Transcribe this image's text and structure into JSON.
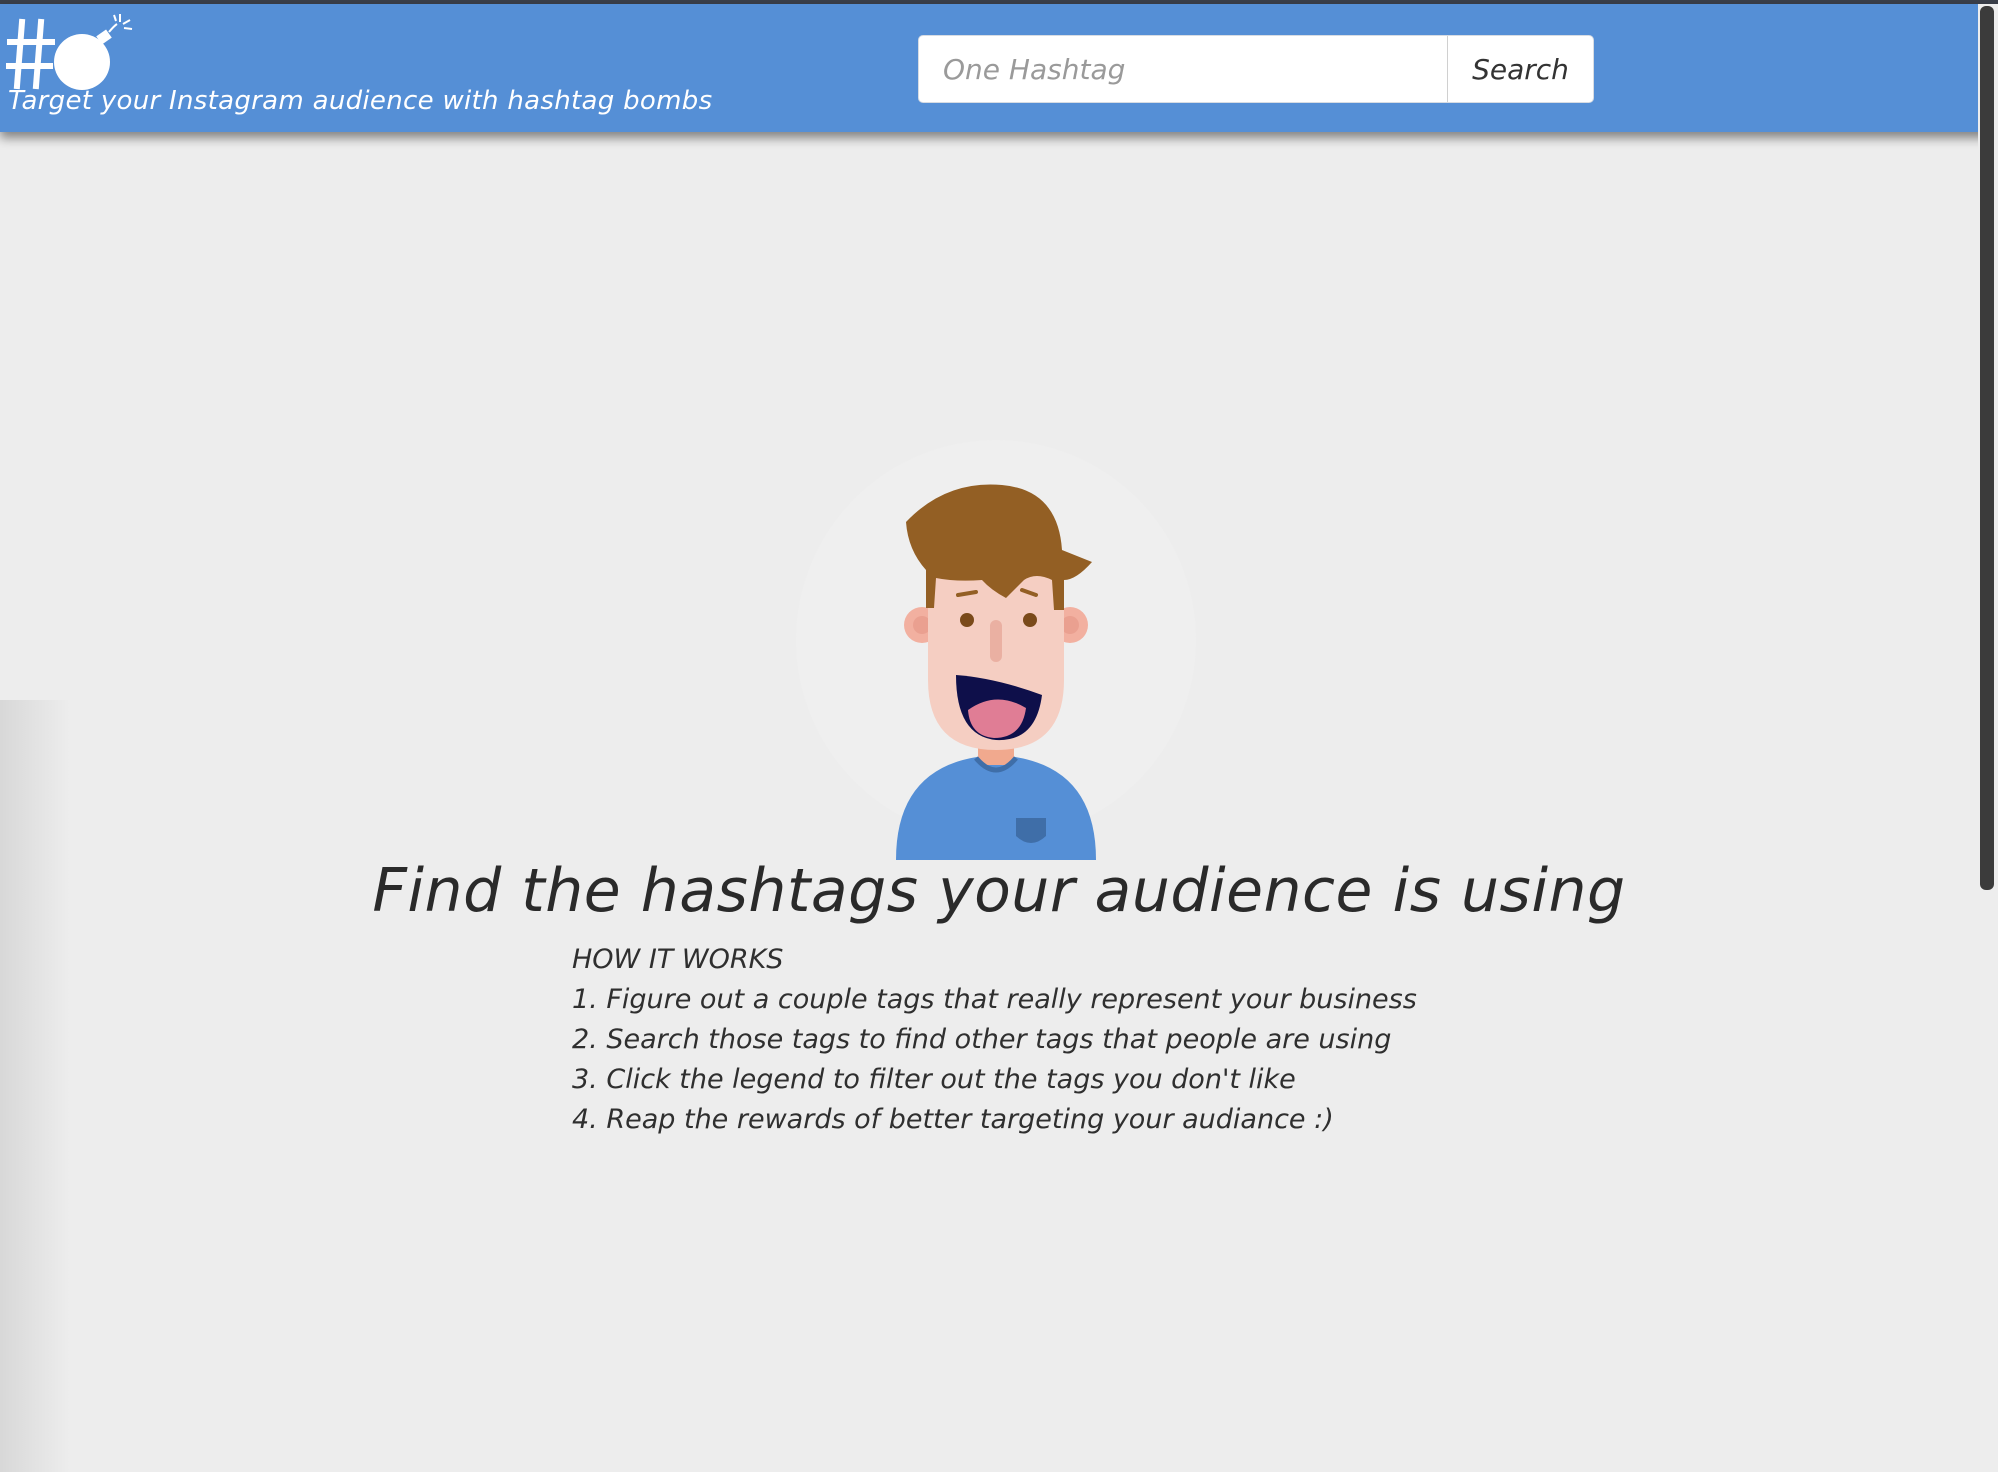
{
  "header": {
    "tagline": "Target your Instagram audience with hashtag bombs",
    "logo_icon": "hashtag-bomb-logo",
    "background_color": "#558fd6"
  },
  "search": {
    "placeholder": "One Hashtag",
    "value": "",
    "button_label": "Search"
  },
  "main": {
    "illustration_icon": "smiling-man-illustration",
    "headline": "Find the hashtags your audience is using",
    "how_it_works": {
      "title": "HOW IT WORKS",
      "steps": [
        "1. Figure out a couple tags that really represent your business",
        "2. Search those tags to find other tags that people are using",
        "3. Click the legend to filter out the tags you don't like",
        "4. Reap the rewards of better targeting your audiance :)"
      ]
    }
  }
}
